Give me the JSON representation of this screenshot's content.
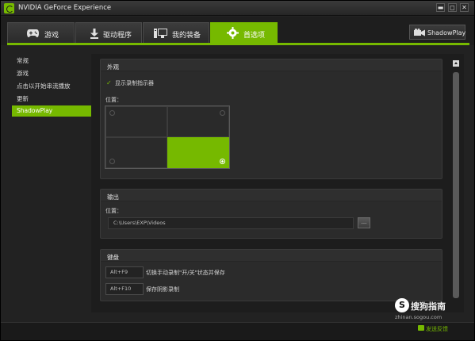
{
  "window": {
    "title": "NVIDIA GeForce Experience"
  },
  "titlebar": {
    "minimize": "▬",
    "restore": "◻",
    "close": "✕"
  },
  "tabs": [
    {
      "label": "游戏",
      "icon": "gamepad-icon"
    },
    {
      "label": "驱动程序",
      "icon": "download-icon"
    },
    {
      "label": "我的装备",
      "icon": "monitor-icon"
    },
    {
      "label": "首选项",
      "icon": "gear-icon"
    }
  ],
  "shadowplay_button": {
    "label": "ShadowPlay",
    "icon": "camera-icon"
  },
  "sidebar": {
    "items": [
      {
        "label": "常规"
      },
      {
        "label": "游戏"
      },
      {
        "label": "点击以开始串流播放"
      },
      {
        "label": "更新"
      },
      {
        "label": "ShadowPlay"
      }
    ],
    "active_index": 4
  },
  "appearance": {
    "title": "外观",
    "checkbox_label": "显示录制指示器",
    "checkbox_checked": true,
    "position_label": "位置："
  },
  "output": {
    "title": "输出",
    "position_label": "位置：",
    "path": "C:\\Users\\EXP\\Videos",
    "browse_label": "..."
  },
  "keyboard": {
    "title": "键盘",
    "shortcuts": [
      {
        "key": "Alt+F9",
        "description": "切换手动录制\"开/关\"状态并保存"
      },
      {
        "key": "Alt+F10",
        "description": "保存阴影录制"
      }
    ]
  },
  "watermark": {
    "logo": "S",
    "text": "搜狗指南",
    "url": "zhinan.sogou.com"
  },
  "footer": {
    "feedback": "发送反馈"
  },
  "colors": {
    "accent": "#76b900",
    "background": "#222222"
  }
}
